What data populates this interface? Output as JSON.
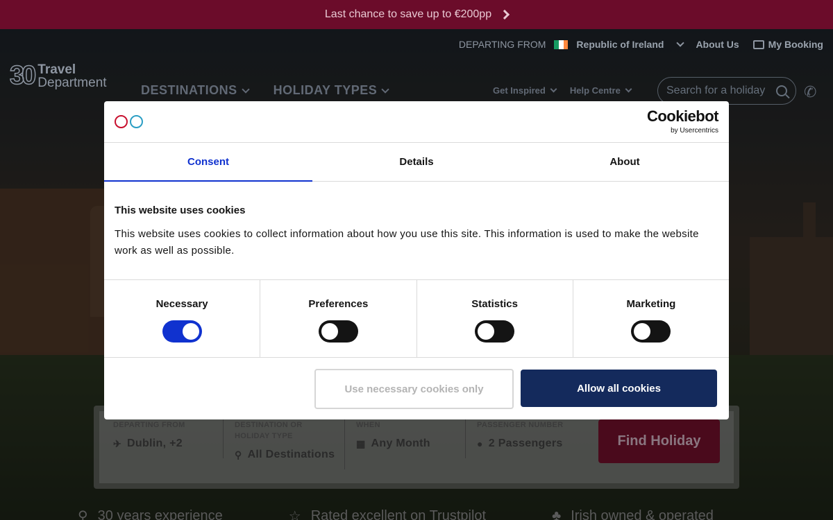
{
  "promo": {
    "text": "Last chance to save up to €200pp"
  },
  "header": {
    "departing_label": "DEPARTING FROM",
    "country": "Republic of Ireland",
    "about": "About Us",
    "booking": "My Booking",
    "logo_line1": "Travel",
    "logo_line2": "Department",
    "logo_mark": "30",
    "nav": [
      "DESTINATIONS",
      "HOLIDAY TYPES"
    ],
    "subnav": [
      "Get Inspired",
      "Help Centre"
    ],
    "search_placeholder": "Search for a holiday"
  },
  "widget": {
    "fields": [
      {
        "label": "DEPARTING FROM",
        "value": "Dublin, +2",
        "icon": "plane-icon"
      },
      {
        "label": "DESTINATION OR HOLIDAY TYPE",
        "value": "All Destinations",
        "icon": "map-pin-icon"
      },
      {
        "label": "WHEN",
        "value": "Any Month",
        "icon": "calendar-icon"
      },
      {
        "label": "PASSENGER NUMBER",
        "value": "2 Passengers",
        "icon": "person-icon"
      }
    ],
    "button": "Find Holiday"
  },
  "usps": [
    "30 years experience",
    "Rated excellent on Trustpilot",
    "Irish owned & operated"
  ],
  "cookie": {
    "brand": "Cookiebot",
    "brand_sub": "by Usercentrics",
    "tabs": [
      "Consent",
      "Details",
      "About"
    ],
    "active_tab": "Consent",
    "heading": "This website uses cookies",
    "body": "This website uses cookies to collect information about how you use this site. This information is used to make the website work as well as possible.",
    "categories": [
      {
        "name": "Necessary",
        "on": true
      },
      {
        "name": "Preferences",
        "on": false
      },
      {
        "name": "Statistics",
        "on": false
      },
      {
        "name": "Marketing",
        "on": false
      }
    ],
    "btn_necessary": "Use necessary cookies only",
    "btn_all": "Allow all cookies"
  },
  "colors": {
    "promo_bg": "#6b0c2a",
    "accent_blue": "#1032cf",
    "allow_btn": "#142a5c"
  }
}
